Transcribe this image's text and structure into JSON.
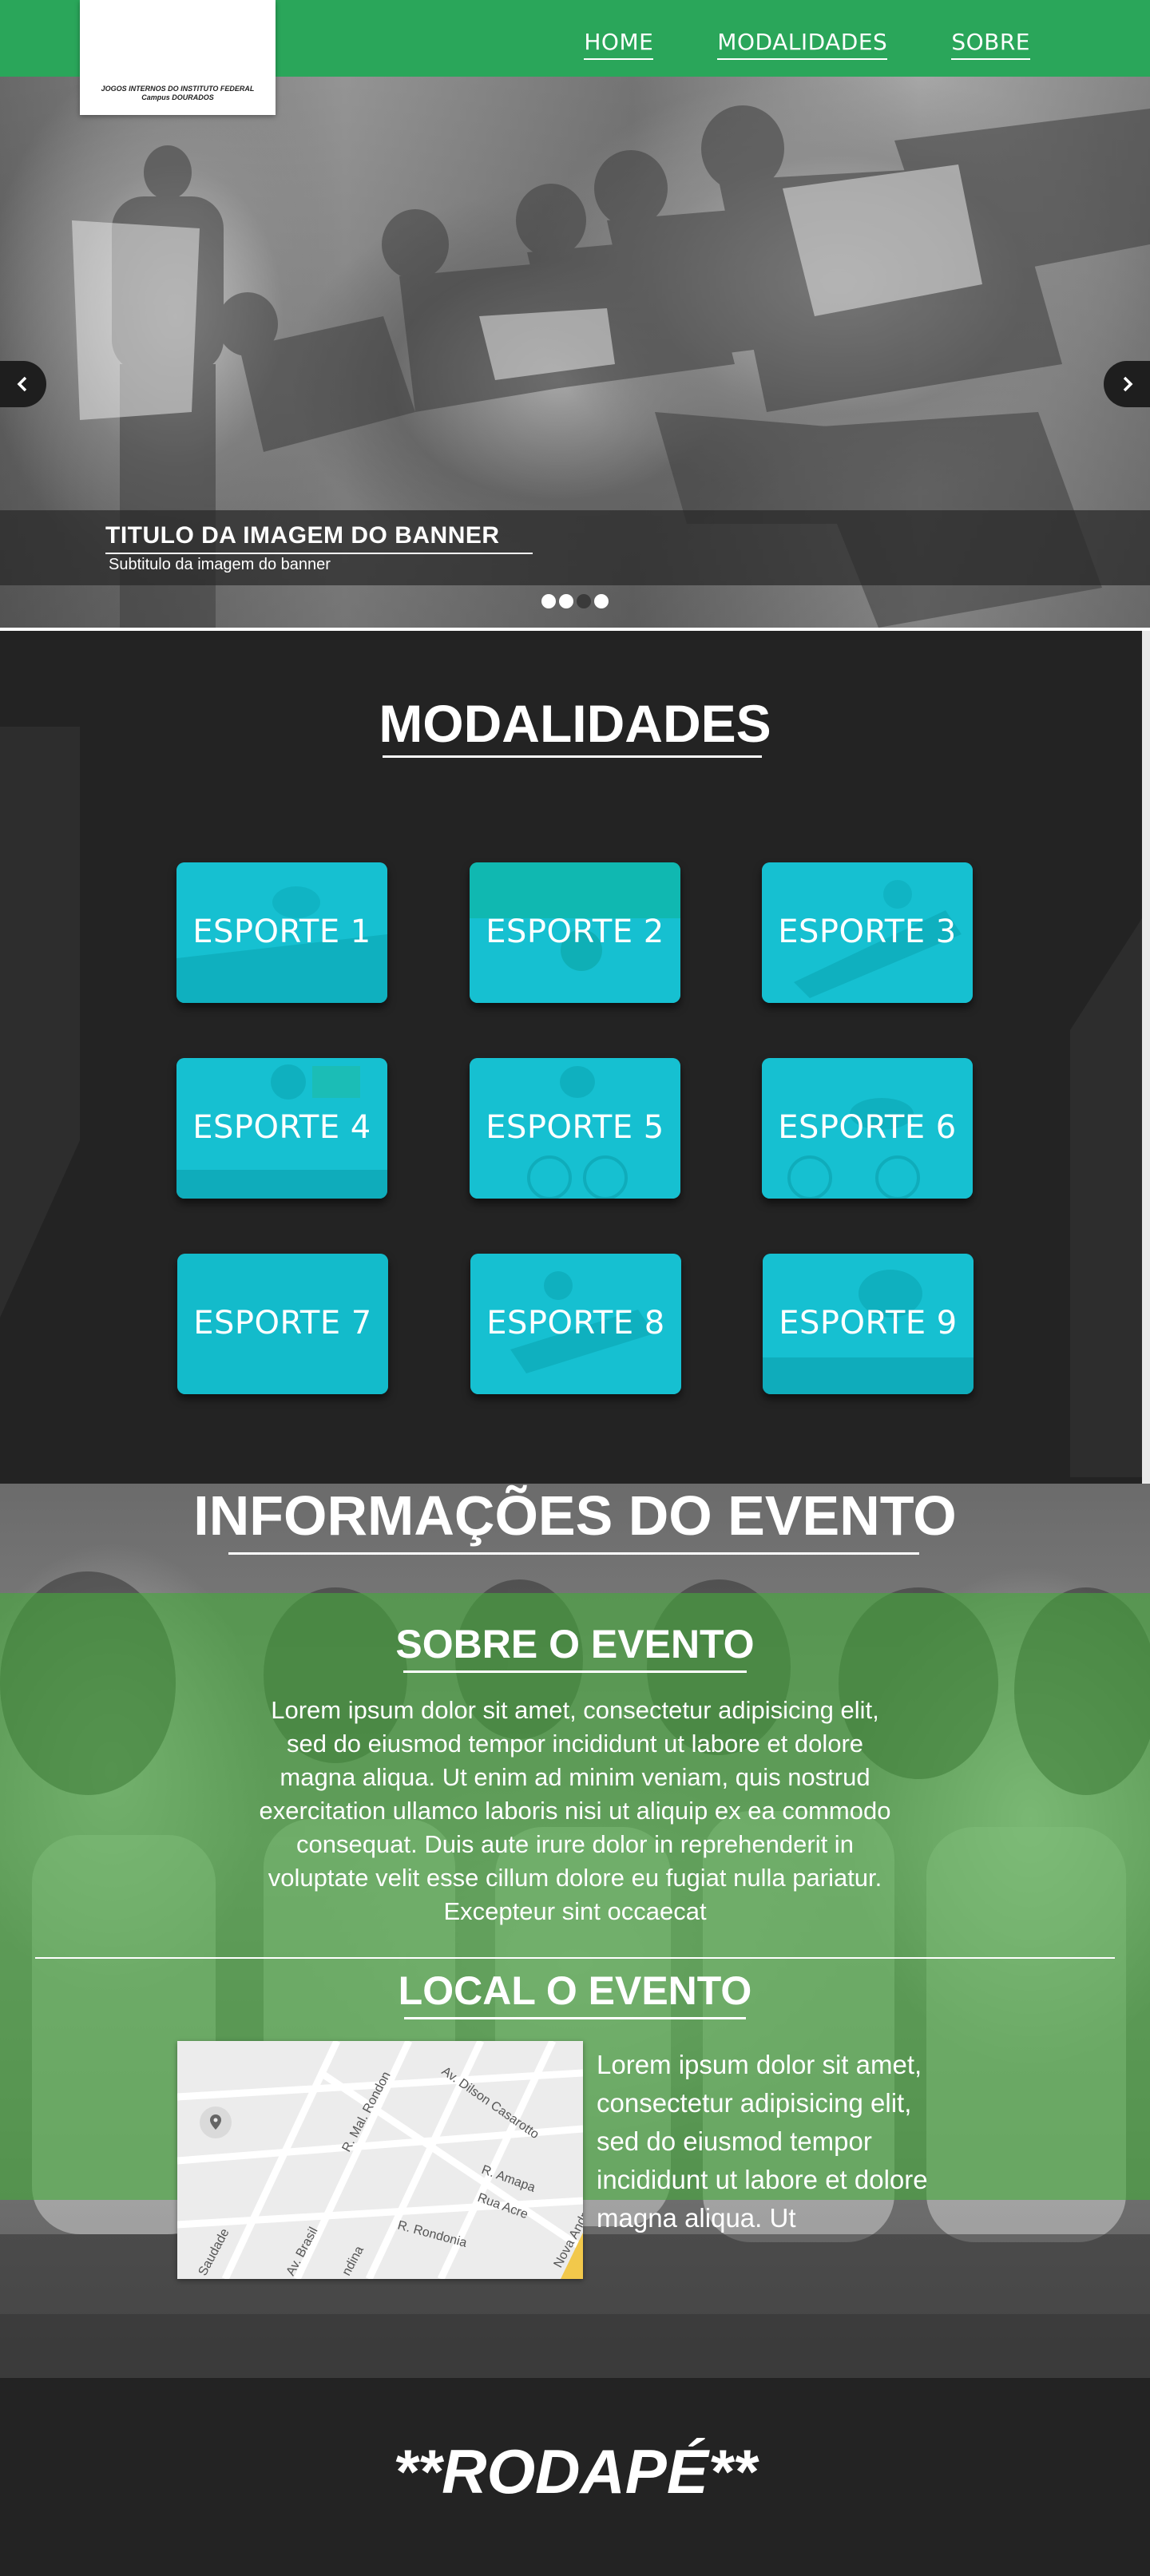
{
  "header": {
    "logo_text": "JOGOS INTERNOS DO INSTITUTO FEDERAL Campus DOURADOS",
    "nav": [
      "HOME",
      "MODALIDADES",
      "SOBRE"
    ]
  },
  "banner": {
    "title": "TITULO DA IMAGEM DO BANNER",
    "subtitle": "Subtitulo da imagem do banner",
    "prev_icon": "chevron-left-icon",
    "next_icon": "chevron-right-icon",
    "slides": 4,
    "active_slide": 3
  },
  "modalidades": {
    "title": "MODALIDADES",
    "sports": [
      "ESPORTE 1",
      "ESPORTE 2",
      "ESPORTE 3",
      "ESPORTE 4",
      "ESPORTE 5",
      "ESPORTE 6",
      "ESPORTE 7",
      "ESPORTE 8",
      "ESPORTE 9"
    ]
  },
  "info": {
    "title": "INFORMAÇÕES DO EVENTO",
    "about_title": "SOBRE O EVENTO",
    "about_text": "Lorem ipsum dolor sit amet, consectetur adipisicing elit, sed do eiusmod tempor incididunt ut labore et dolore magna aliqua. Ut enim ad minim veniam, quis nostrud exercitation ullamco laboris nisi ut aliquip ex ea commodo consequat. Duis aute irure dolor in reprehenderit in voluptate velit esse cillum dolore eu fugiat nulla pariatur. Excepteur sint occaecat",
    "local_title": "LOCAL O EVENTO",
    "local_text": "Lorem ipsum dolor sit amet, consectetur adipisicing elit, sed do eiusmod tempor incididunt ut labore et dolore magna aliqua. Ut",
    "map_labels": [
      "Av. Dilson Casarotto",
      "R. Mal. Rondon",
      "R. Amapa",
      "Rua Acre",
      "R. Rondonia",
      "Nova Andradina",
      "Av. Brasil",
      "Saudade",
      "ndina"
    ]
  },
  "footer": {
    "text": "**RODAPÉ**"
  },
  "colors": {
    "header_green": "#2aa65a",
    "panel_green": "#46aa3c",
    "tile_cyan": "#12c4d4",
    "dark_bg": "#232323"
  }
}
